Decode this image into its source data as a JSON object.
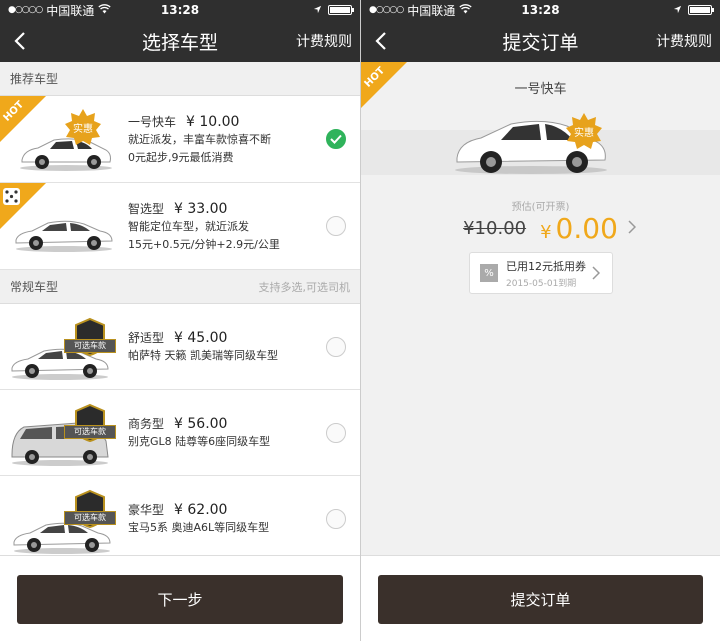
{
  "left": {
    "status": {
      "carrier": "中国联通",
      "time": "13:28"
    },
    "nav": {
      "title": "选择车型",
      "rule": "计费规则"
    },
    "recommended_header": "推荐车型",
    "regular_header": "常规车型",
    "regular_hint": "支持多选,可选司机",
    "cars": [
      {
        "name": "一号快车",
        "price": "¥ 10.00",
        "desc1": "就近派发，丰富车款惊喜不断",
        "desc2": "0元起步,9元最低消费",
        "badge": "实惠",
        "hot": "HOT",
        "checked": true
      },
      {
        "name": "智选型",
        "price": "¥ 33.00",
        "desc1": "智能定位车型，就近派发",
        "desc2": "15元+0.5元/分钟+2.9元/公里",
        "checked": false
      },
      {
        "name": "舒适型",
        "price": "¥ 45.00",
        "desc1": "帕萨特 天籁 凯美瑞等同级车型",
        "banner": "可选车款",
        "checked": false
      },
      {
        "name": "商务型",
        "price": "¥ 56.00",
        "desc1": "别克GL8 陆尊等6座同级车型",
        "banner": "可选车款",
        "checked": false
      },
      {
        "name": "豪华型",
        "price": "¥ 62.00",
        "desc1": "宝马5系 奥迪A6L等同级车型",
        "banner": "可选车款",
        "checked": false
      }
    ],
    "next_button": "下一步"
  },
  "right": {
    "status": {
      "carrier": "中国联通",
      "time": "13:28"
    },
    "nav": {
      "title": "提交订单",
      "rule": "计费规则"
    },
    "hot": "HOT",
    "car_name": "一号快车",
    "car_badge": "实惠",
    "estimate_label": "预估(可开票)",
    "old_price": "¥10.00",
    "currency": "¥",
    "new_price": "0.00",
    "coupon_icon": "%",
    "coupon_title": "已用12元抵用券",
    "coupon_expiry": "2015-05-01到期",
    "submit_button": "提交订单"
  },
  "colors": {
    "accent": "#f0a81b",
    "nav": "#2f2f2f",
    "button": "#3a302b",
    "check": "#2fb35b"
  },
  "battery_level": 0.9
}
